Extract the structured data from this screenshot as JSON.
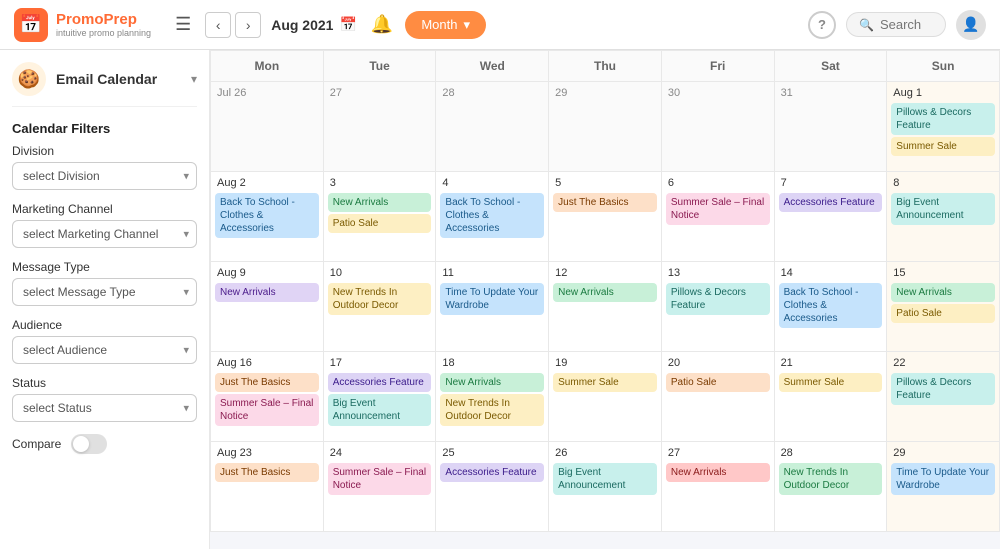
{
  "header": {
    "logo_emoji": "📅",
    "logo_title": "PromoPrep",
    "logo_subtitle": "intuitive promo planning",
    "current_period": "Aug 2021",
    "view_label": "Month",
    "search_placeholder": "Search",
    "help_label": "?"
  },
  "sidebar": {
    "icon_emoji": "🍪",
    "title": "Email Calendar",
    "filters_title": "Calendar Filters",
    "filters": [
      {
        "label": "Division",
        "placeholder": "select Division"
      },
      {
        "label": "Marketing Channel",
        "placeholder": "select Marketing Channel"
      },
      {
        "label": "Message Type",
        "placeholder": "select Message Type"
      },
      {
        "label": "Audience",
        "placeholder": "select Audience"
      },
      {
        "label": "Status",
        "placeholder": "select Status"
      }
    ],
    "compare_label": "Compare"
  },
  "calendar": {
    "headers": [
      "Mon",
      "Tue",
      "Wed",
      "Thu",
      "Fri",
      "Sat",
      "Sun"
    ],
    "weeks": [
      {
        "cells": [
          {
            "date": "Jul 26",
            "other": true,
            "events": []
          },
          {
            "date": "27",
            "other": true,
            "events": []
          },
          {
            "date": "28",
            "other": true,
            "events": []
          },
          {
            "date": "29",
            "other": true,
            "events": []
          },
          {
            "date": "30",
            "other": true,
            "events": []
          },
          {
            "date": "31",
            "other": true,
            "events": []
          },
          {
            "date": "Aug 1",
            "sun": true,
            "events": [
              {
                "text": "Pillows & Decors Feature",
                "color": "teal"
              },
              {
                "text": "Summer Sale",
                "color": "yellow"
              }
            ]
          }
        ]
      },
      {
        "cells": [
          {
            "date": "Aug 2",
            "events": [
              {
                "text": "Back To School - Clothes & Accessories",
                "color": "blue"
              }
            ]
          },
          {
            "date": "3",
            "events": [
              {
                "text": "New Arrivals",
                "color": "green"
              },
              {
                "text": "Patio Sale",
                "color": "yellow"
              }
            ]
          },
          {
            "date": "4",
            "events": [
              {
                "text": "Back To School - Clothes & Accessories",
                "color": "blue"
              }
            ]
          },
          {
            "date": "5",
            "events": [
              {
                "text": "Just The Basics",
                "color": "orange"
              }
            ]
          },
          {
            "date": "6",
            "events": [
              {
                "text": "Summer Sale – Final Notice",
                "color": "pink"
              }
            ]
          },
          {
            "date": "7",
            "events": [
              {
                "text": "Accessories Feature",
                "color": "lavender"
              }
            ]
          },
          {
            "date": "8",
            "sun": true,
            "events": [
              {
                "text": "Big Event Announcement",
                "color": "teal"
              }
            ]
          }
        ]
      },
      {
        "cells": [
          {
            "date": "Aug 9",
            "events": [
              {
                "text": "New Arrivals",
                "color": "purple"
              }
            ]
          },
          {
            "date": "10",
            "events": [
              {
                "text": "New Trends In Outdoor Decor",
                "color": "yellow"
              }
            ]
          },
          {
            "date": "11",
            "events": [
              {
                "text": "Time To Update Your Wardrobe",
                "color": "blue"
              }
            ]
          },
          {
            "date": "12",
            "events": [
              {
                "text": "New Arrivals",
                "color": "green"
              }
            ]
          },
          {
            "date": "13",
            "events": [
              {
                "text": "Pillows & Decors Feature",
                "color": "teal"
              }
            ]
          },
          {
            "date": "14",
            "events": [
              {
                "text": "Back To School - Clothes & Accessories",
                "color": "blue"
              }
            ]
          },
          {
            "date": "15",
            "sun": true,
            "events": [
              {
                "text": "New Arrivals",
                "color": "green"
              },
              {
                "text": "Patio Sale",
                "color": "yellow"
              }
            ]
          }
        ]
      },
      {
        "cells": [
          {
            "date": "Aug 16",
            "events": [
              {
                "text": "Just The Basics",
                "color": "orange"
              },
              {
                "text": "Summer Sale – Final Notice",
                "color": "pink"
              }
            ]
          },
          {
            "date": "17",
            "events": [
              {
                "text": "Accessories Feature",
                "color": "lavender"
              },
              {
                "text": "Big Event Announcement",
                "color": "teal"
              }
            ]
          },
          {
            "date": "18",
            "events": [
              {
                "text": "New Arrivals",
                "color": "green"
              },
              {
                "text": "New Trends In Outdoor Decor",
                "color": "yellow"
              }
            ]
          },
          {
            "date": "19",
            "events": [
              {
                "text": "Summer Sale",
                "color": "yellow"
              }
            ]
          },
          {
            "date": "20",
            "events": [
              {
                "text": "Patio Sale",
                "color": "orange"
              }
            ]
          },
          {
            "date": "21",
            "events": [
              {
                "text": "Summer Sale",
                "color": "yellow"
              }
            ]
          },
          {
            "date": "22",
            "sun": true,
            "events": [
              {
                "text": "Pillows & Decors Feature",
                "color": "teal"
              }
            ]
          }
        ]
      },
      {
        "cells": [
          {
            "date": "Aug 23",
            "events": [
              {
                "text": "Just The Basics",
                "color": "orange"
              }
            ]
          },
          {
            "date": "24",
            "events": [
              {
                "text": "Summer Sale – Final Notice",
                "color": "pink"
              }
            ]
          },
          {
            "date": "25",
            "events": [
              {
                "text": "Accessories Feature",
                "color": "lavender"
              }
            ]
          },
          {
            "date": "26",
            "events": [
              {
                "text": "Big Event Announcement",
                "color": "teal"
              }
            ]
          },
          {
            "date": "27",
            "events": [
              {
                "text": "New Arrivals",
                "color": "red"
              }
            ]
          },
          {
            "date": "28",
            "events": [
              {
                "text": "New Trends In Outdoor Decor",
                "color": "green"
              }
            ]
          },
          {
            "date": "29",
            "sun": true,
            "events": [
              {
                "text": "Time To Update Your Wardrobe",
                "color": "blue"
              }
            ]
          }
        ]
      }
    ]
  }
}
